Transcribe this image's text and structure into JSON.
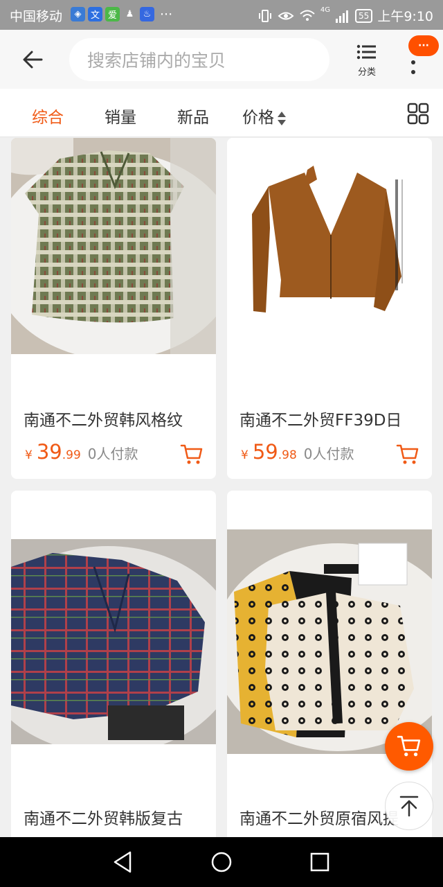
{
  "status_bar": {
    "carrier": "中国移动",
    "app_icons": [
      {
        "name": "shield-icon",
        "glyph": "◈",
        "color": "#3a7bd5"
      },
      {
        "name": "translate-icon",
        "glyph": "文",
        "color": "#2d6fe0"
      },
      {
        "name": "iqiyi-icon",
        "glyph": "爱",
        "color": "#4cb848"
      },
      {
        "name": "qq-icon",
        "glyph": "♟",
        "color": "#9a9a9a"
      },
      {
        "name": "baidu-icon",
        "glyph": "♨",
        "color": "#3568e0"
      }
    ],
    "ellipsis": "···",
    "network": "4G",
    "battery": "55",
    "time": "上午9:10"
  },
  "header": {
    "search_placeholder": "搜索店铺内的宝贝",
    "category_label": "分类",
    "more_label": "···"
  },
  "sort_bar": {
    "tabs": [
      {
        "label": "综合",
        "active": true
      },
      {
        "label": "销量",
        "active": false
      },
      {
        "label": "新品",
        "active": false
      },
      {
        "label": "价格",
        "active": false
      }
    ]
  },
  "products": [
    {
      "title": "南通不二外贸韩风格纹",
      "price_symbol": "¥",
      "price_int": "39",
      "price_dec": ".99",
      "sold": "0人付款"
    },
    {
      "title": "南通不二外贸FF39D日",
      "price_symbol": "¥",
      "price_int": "59",
      "price_dec": ".98",
      "sold": "0人付款"
    },
    {
      "title": "南通不二外贸韩版复古"
    },
    {
      "title": "南通不二外贸原宿风提"
    }
  ],
  "colors": {
    "accent": "#f05a16",
    "float_cart": "#ff5a00"
  }
}
